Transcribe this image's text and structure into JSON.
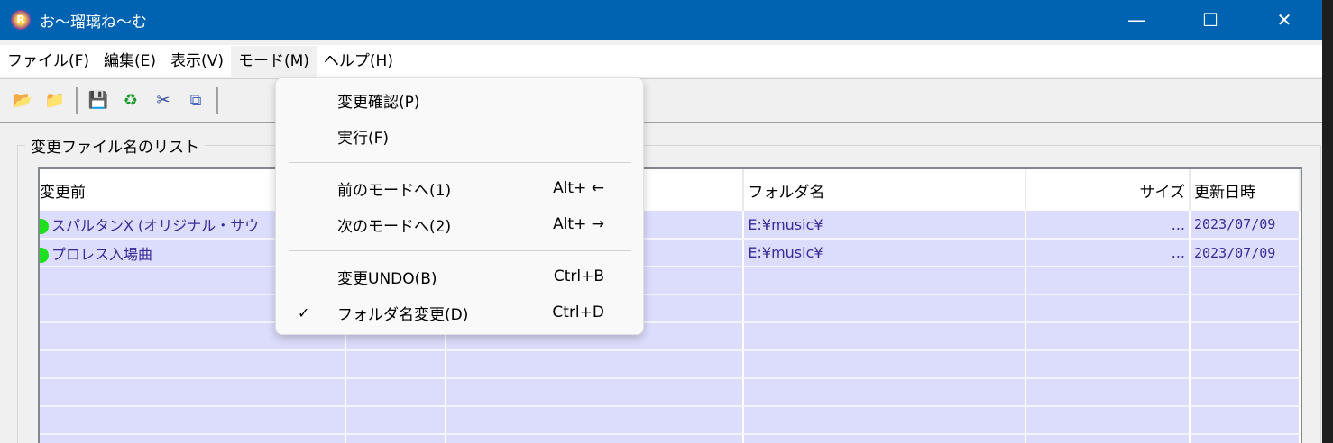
{
  "window": {
    "title": "お〜瑠璃ね〜む",
    "minimize": "—",
    "maximize": "☐",
    "close": "✕"
  },
  "menubar": [
    "ファイル(F)",
    "編集(E)",
    "表示(V)",
    "モード(M)",
    "ヘルプ(H)"
  ],
  "toolbar": {
    "icons": [
      "open-folder-icon",
      "open-folder-alt-icon",
      "save-icon",
      "refresh-icon",
      "cut-icon",
      "copy-icon"
    ]
  },
  "group_label": "変更ファイル名のリスト",
  "table": {
    "columns": [
      "変更前",
      "",
      "",
      "フォルダ名",
      "サイズ",
      "更新日時"
    ],
    "rows": [
      {
        "name": "スパルタンX (オリジナル・サウ",
        "folder": "E:¥music¥",
        "size": "...",
        "date": "2023/07/09"
      },
      {
        "name": "プロレス入場曲",
        "folder": "E:¥music¥",
        "size": "...",
        "date": "2023/07/09"
      }
    ]
  },
  "mode_menu": {
    "items": [
      {
        "label": "変更確認(P)",
        "shortcut": "",
        "checked": false
      },
      {
        "label": "実行(F)",
        "shortcut": "",
        "checked": false
      },
      {
        "label": "前のモードへ(1)",
        "shortcut": "Alt+ ←",
        "checked": false
      },
      {
        "label": "次のモードへ(2)",
        "shortcut": "Alt+ →",
        "checked": false
      },
      {
        "label": "変更UNDO(B)",
        "shortcut": "Ctrl+B",
        "checked": false
      },
      {
        "label": "フォルダ名変更(D)",
        "shortcut": "Ctrl+D",
        "checked": true
      }
    ],
    "check_mark": "✓"
  }
}
